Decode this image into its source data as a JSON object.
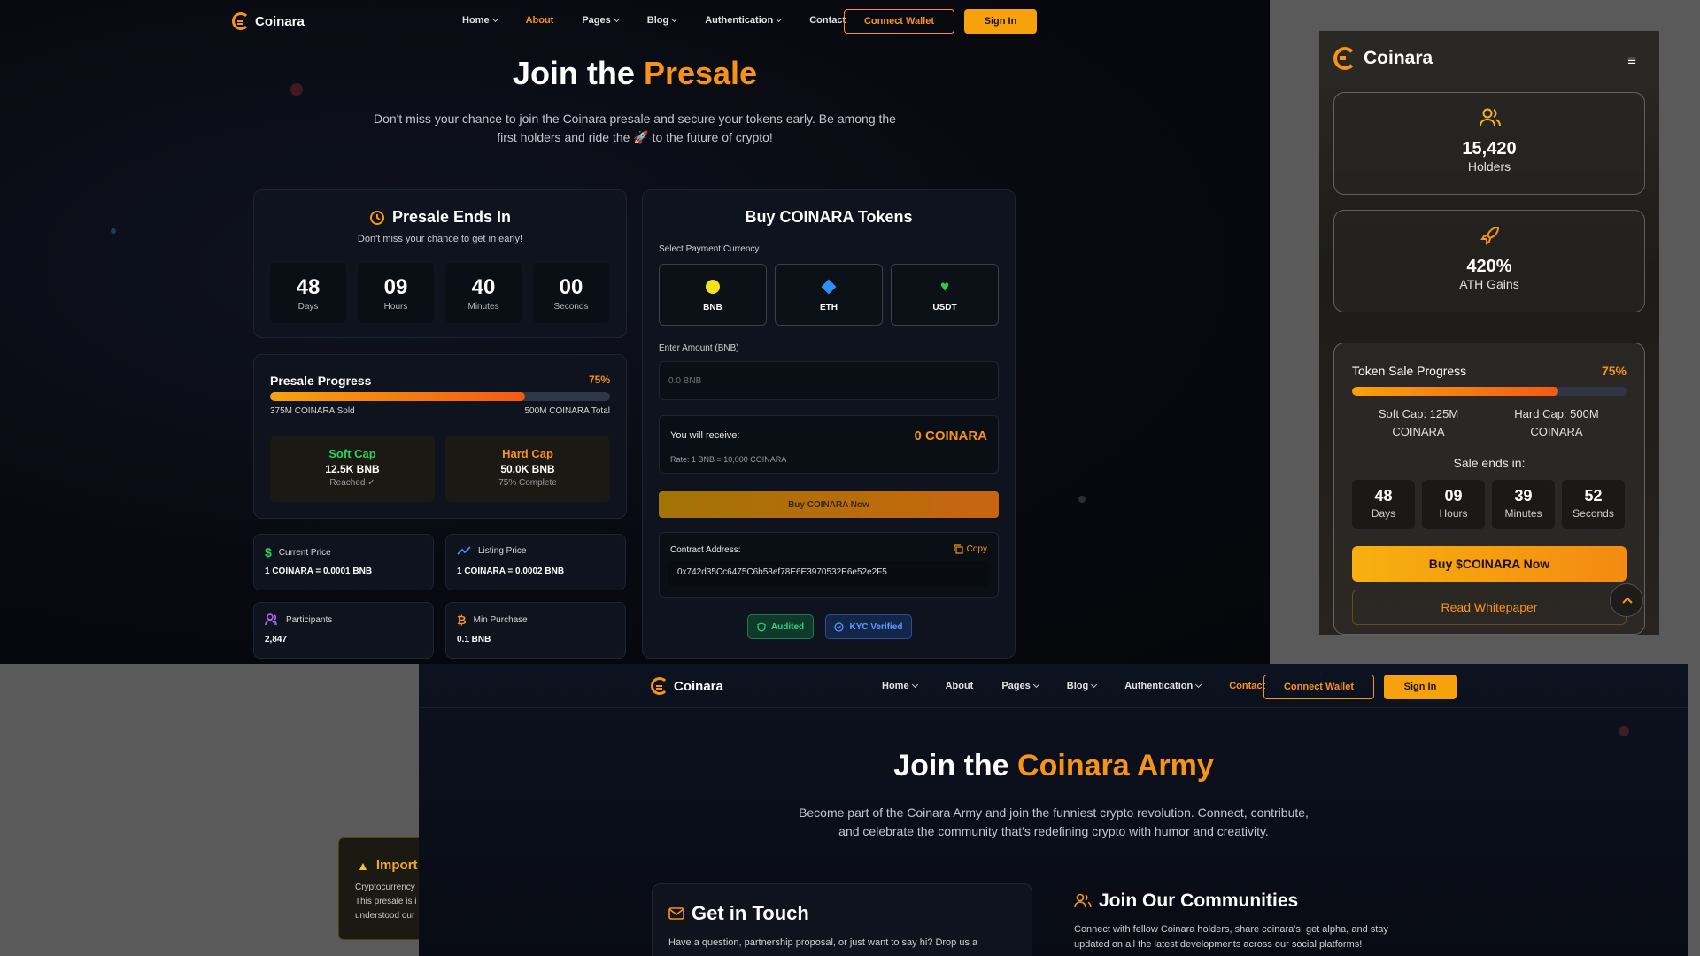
{
  "brand": {
    "name": "Coinara",
    "accent": "#f7931a"
  },
  "presale_page": {
    "nav": {
      "items": [
        {
          "label": "Home",
          "dropdown": true
        },
        {
          "label": "About",
          "active": true
        },
        {
          "label": "Pages",
          "dropdown": true
        },
        {
          "label": "Blog",
          "dropdown": true
        },
        {
          "label": "Authentication",
          "dropdown": true
        },
        {
          "label": "Contact"
        }
      ],
      "connect_wallet": "Connect Wallet",
      "sign_in": "Sign In"
    },
    "hero": {
      "title_prefix": "Join the",
      "title_accent": "Presale",
      "subtitle_line1": "Don't miss your chance to join the Coinara presale and secure your tokens early. Be among the",
      "subtitle_line2": "first holders and ride the 🚀 to the future of crypto!"
    },
    "countdown_card": {
      "title": "Presale Ends In",
      "subtitle": "Don't miss your chance to get in early!",
      "units": [
        {
          "value": "48",
          "label": "Days"
        },
        {
          "value": "09",
          "label": "Hours"
        },
        {
          "value": "40",
          "label": "Minutes"
        },
        {
          "value": "00",
          "label": "Seconds"
        }
      ]
    },
    "progress_card": {
      "title": "Presale Progress",
      "percent_label": "75%",
      "fill_fraction": 0.75,
      "sold_label": "375M COINARA Sold",
      "total_label": "500M COINARA Total",
      "soft_cap": {
        "title": "Soft Cap",
        "value": "12.5K BNB",
        "status": "Reached ✓"
      },
      "hard_cap": {
        "title": "Hard Cap",
        "value": "50.0K BNB",
        "status": "75% Complete"
      }
    },
    "stats": [
      {
        "label": "Current Price",
        "value": "1 COINARA = 0.0001 BNB",
        "icon": "dollar-icon"
      },
      {
        "label": "Listing Price",
        "value": "1 COINARA = 0.0002 BNB",
        "icon": "trend-up-icon"
      },
      {
        "label": "Participants",
        "value": "2,847",
        "icon": "users-icon"
      },
      {
        "label": "Min Purchase",
        "value": "0.1 BNB",
        "icon": "bitcoin-icon"
      }
    ],
    "buy_card": {
      "title": "Buy COINARA Tokens",
      "currency_label": "Select Payment Currency",
      "currencies": [
        {
          "label": "BNB",
          "color": "#f3e21a"
        },
        {
          "label": "ETH",
          "color": "#2f8df5"
        },
        {
          "label": "USDT",
          "color": "#28d14a"
        }
      ],
      "amount_label": "Enter Amount (BNB)",
      "amount_placeholder": "0.0 BNB",
      "receive_label": "You will receive:",
      "receive_value": "0 COINARA",
      "rate": "Rate: 1 BNB = 10,000 COINARA",
      "buy_button": "Buy COINARA Now",
      "contract_label": "Contract Address:",
      "copy_label": "Copy",
      "contract_address": "0x742d35Cc6475C6b58ef78E6E3970532E6e52e2F5",
      "audited": "Audited",
      "kyc": "KYC Verified"
    },
    "warning": {
      "title": "Import",
      "lines": [
        "Cryptocurrency",
        "This presale is i",
        "understood our"
      ]
    }
  },
  "mobile": {
    "holders": {
      "value": "15,420",
      "label": "Holders"
    },
    "gains": {
      "value": "420%",
      "label": "ATH Gains"
    },
    "sale": {
      "title": "Token Sale Progress",
      "percent_label": "75%",
      "fill_fraction": 0.75,
      "soft_cap_line1": "Soft Cap: 125M",
      "soft_cap_line2": "COINARA",
      "hard_cap_line1": "Hard Cap: 500M",
      "hard_cap_line2": "COINARA",
      "ends_label": "Sale ends in:",
      "units": [
        {
          "value": "48",
          "label": "Days"
        },
        {
          "value": "09",
          "label": "Hours"
        },
        {
          "value": "39",
          "label": "Minutes"
        },
        {
          "value": "52",
          "label": "Seconds"
        }
      ],
      "buy_button": "Buy $COINARA Now",
      "whitepaper_button": "Read Whitepaper"
    }
  },
  "army_page": {
    "nav": {
      "items": [
        {
          "label": "Home",
          "dropdown": true
        },
        {
          "label": "About"
        },
        {
          "label": "Pages",
          "dropdown": true
        },
        {
          "label": "Blog",
          "dropdown": true
        },
        {
          "label": "Authentication",
          "dropdown": true
        },
        {
          "label": "Contact",
          "active": true
        }
      ],
      "connect_wallet": "Connect Wallet",
      "sign_in": "Sign In"
    },
    "hero": {
      "title_prefix": "Join the",
      "title_accent": "Coinara Army",
      "subtitle_line1": "Become part of the Coinara Army and join the funniest crypto revolution. Connect, contribute,",
      "subtitle_line2": "and celebrate the community that's redefining crypto with humor and creativity."
    },
    "contact": {
      "title": "Get in Touch",
      "text": "Have a question, partnership proposal, or just want to say hi? Drop us a"
    },
    "communities": {
      "title": "Join Our Communities",
      "text_line1": "Connect with fellow Coinara holders, share coinara's, get alpha, and stay",
      "text_line2": "updated on all the latest developments across our social platforms!"
    }
  }
}
